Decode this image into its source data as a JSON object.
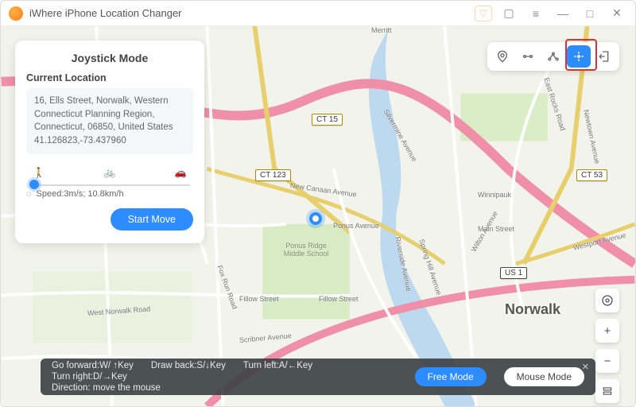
{
  "app": {
    "title": "iWhere iPhone Location Changer"
  },
  "panel": {
    "mode_title": "Joystick Mode",
    "section_label": "Current Location",
    "address": "16, Ells Street, Norwalk, Western Connecticut Planning Region, Connecticut, 06850, United States 41.126823,-73.437960",
    "transport": {
      "walk": "walk-icon",
      "bike": "bike-icon",
      "car": "car-icon",
      "selected": "walk"
    },
    "speed_label": "Speed:3m/s; 10.8km/h",
    "start_label": "Start Move"
  },
  "modes": {
    "items": [
      "modify-location",
      "one-stop",
      "multi-stop",
      "joystick",
      "export"
    ],
    "active": "joystick"
  },
  "map": {
    "city": "Norwalk",
    "routes": {
      "ct15": "CT 15",
      "ct123": "CT 123",
      "ct53": "CT 53",
      "us1": "US 1"
    },
    "streets": {
      "merritt": "Merritt",
      "new_canaan": "New Canaan Avenue",
      "ponus": "Ponus Avenue",
      "fillow": "Fillow Street",
      "main": "Main Street",
      "westport": "Westport Avenue",
      "east_rocks": "East Rocks Road",
      "newtown": "Newtown Avenue",
      "riverside": "Riverside Avenue",
      "spring_hill": "Spring Hill Avenue",
      "west_norwalk": "West Norwalk Road",
      "fox_run": "Fox Run Road",
      "scribner": "Scribner Avenue",
      "wilton": "Wilton Avenue",
      "silvermine": "Silvermine Avenue",
      "winnipauk": "Winnipauk",
      "ponus_school": "Ponus Ridge Middle School"
    }
  },
  "hint": {
    "forward": "Go forward:W/ ↑Key",
    "back": "Draw back:S/↓Key",
    "left": "Turn left:A/←Key",
    "right": "Turn right:D/→Key",
    "direction": "Direction: move the mouse",
    "free_mode": "Free Mode",
    "mouse_mode": "Mouse Mode"
  },
  "colors": {
    "accent": "#2d8cff",
    "highlight": "#e03131"
  }
}
